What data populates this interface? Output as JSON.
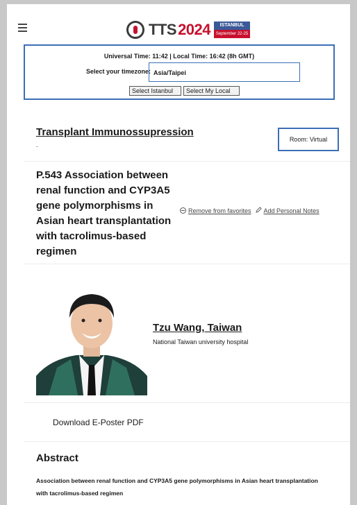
{
  "header": {
    "logo_tts": "TTS",
    "logo_year": "2024",
    "logo_badge_top": "ISTANBUL",
    "logo_badge_bottom": "September 22-25"
  },
  "timezone": {
    "time_line": "Universal Time: 11:42  |  Local Time: 16:42 (8h GMT)",
    "select_label": "Select your timezone:",
    "selected": "Asia/Taipei",
    "btn_istanbul": "Select Istanbul",
    "btn_local": "Select My Local"
  },
  "session": {
    "title": "Transplant Immunossupression",
    "dash": "-",
    "room": "Room: Virtual"
  },
  "poster": {
    "title": "P.543 Association between renal function and CYP3A5 gene polymorphisms in Asian heart transplantation with tacrolimus-based regimen",
    "remove_favorites": "Remove from favorites",
    "add_notes": "Add Personal Notes"
  },
  "author": {
    "name": "Tzu Wang, Taiwan",
    "institution": "National Taiwan university hospital"
  },
  "download_label": "Download E-Poster PDF",
  "abstract": {
    "heading": "Abstract",
    "text": "Association between renal function and CYP3A5 gene polymorphisms in Asian heart transplantation with tacrolimus-based regimen"
  }
}
